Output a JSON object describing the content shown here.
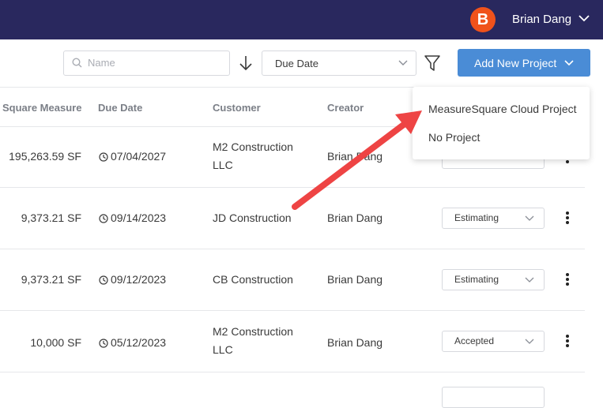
{
  "header": {
    "avatar_initial": "B",
    "user_name": "Brian Dang",
    "brand_color": "#29285e",
    "avatar_color": "#f0521b"
  },
  "toolbar": {
    "search_placeholder": "Name",
    "sort_field": "Due Date",
    "add_button_label": "Add New Project",
    "accent_color": "#4a8cd6"
  },
  "table": {
    "columns": [
      "Square Measure",
      "Due Date",
      "Customer",
      "Creator"
    ],
    "rows": [
      {
        "measure": "195,263.59 SF",
        "due": "07/04/2027",
        "customer": "M2 Construction LLC",
        "creator": "Brian Dang",
        "status": ""
      },
      {
        "measure": "9,373.21 SF",
        "due": "09/14/2023",
        "customer": "JD Construction",
        "creator": "Brian Dang",
        "status": "Estimating"
      },
      {
        "measure": "9,373.21 SF",
        "due": "09/12/2023",
        "customer": "CB Construction",
        "creator": "Brian Dang",
        "status": "Estimating"
      },
      {
        "measure": "10,000 SF",
        "due": "05/12/2023",
        "customer": "M2 Construction LLC",
        "creator": "Brian Dang",
        "status": "Accepted"
      }
    ]
  },
  "dropdown": {
    "items": [
      "MeasureSquare Cloud Project",
      "No Project"
    ]
  },
  "annotation": {
    "arrow_color": "#ee4444"
  }
}
